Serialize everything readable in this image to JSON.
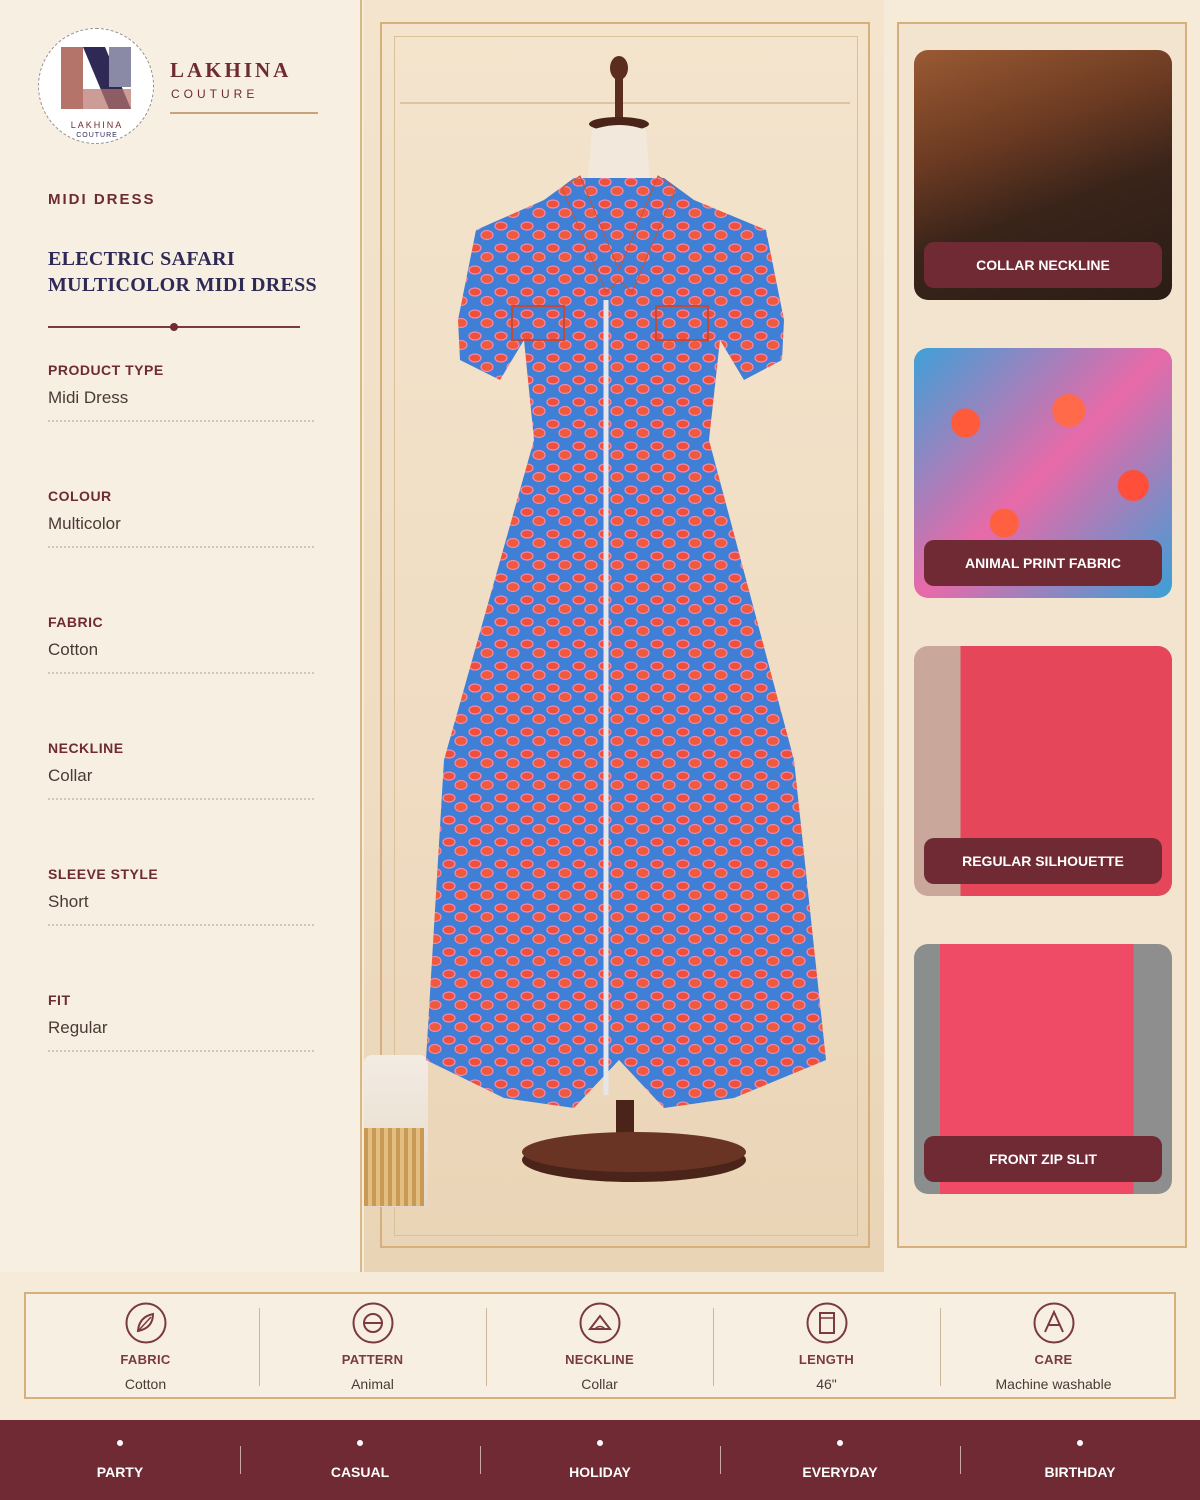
{
  "brand": {
    "name": "LAKHINA",
    "sub": "COUTURE",
    "logo_text": "LAKHINA",
    "logo_sub": "COUTURE"
  },
  "product": {
    "category": "MIDI DRESS",
    "title": "ELECTRIC SAFARI MULTICOLOR MIDI DRESS"
  },
  "specs": [
    {
      "label": "PRODUCT TYPE",
      "value": "Midi Dress"
    },
    {
      "label": "COLOUR",
      "value": "Multicolor"
    },
    {
      "label": "FABRIC",
      "value": "Cotton"
    },
    {
      "label": "NECKLINE",
      "value": "Collar"
    },
    {
      "label": "SLEEVE STYLE",
      "value": "Short"
    },
    {
      "label": "FIT",
      "value": "Regular"
    }
  ],
  "features": [
    {
      "label": "COLLAR NECKLINE"
    },
    {
      "label": "ANIMAL PRINT FABRIC"
    },
    {
      "label": "REGULAR SILHOUETTE"
    },
    {
      "label": "FRONT ZIP SLIT"
    }
  ],
  "attributes": [
    {
      "label": "FABRIC",
      "value": "Cotton",
      "icon": "leaf-icon"
    },
    {
      "label": "PATTERN",
      "value": "Animal",
      "icon": "pattern-icon"
    },
    {
      "label": "NECKLINE",
      "value": "Collar",
      "icon": "neckline-icon"
    },
    {
      "label": "LENGTH",
      "value": "46\"",
      "icon": "length-icon"
    },
    {
      "label": "CARE",
      "value": "Machine washable",
      "icon": "care-icon"
    }
  ],
  "occasions": [
    "PARTY",
    "CASUAL",
    "HOLIDAY",
    "EVERYDAY",
    "BIRTHDAY"
  ],
  "colors": {
    "maroon": "#6f2a33",
    "gold": "#d6b07c",
    "navy": "#2f2a55",
    "cream": "#f8efe3"
  }
}
